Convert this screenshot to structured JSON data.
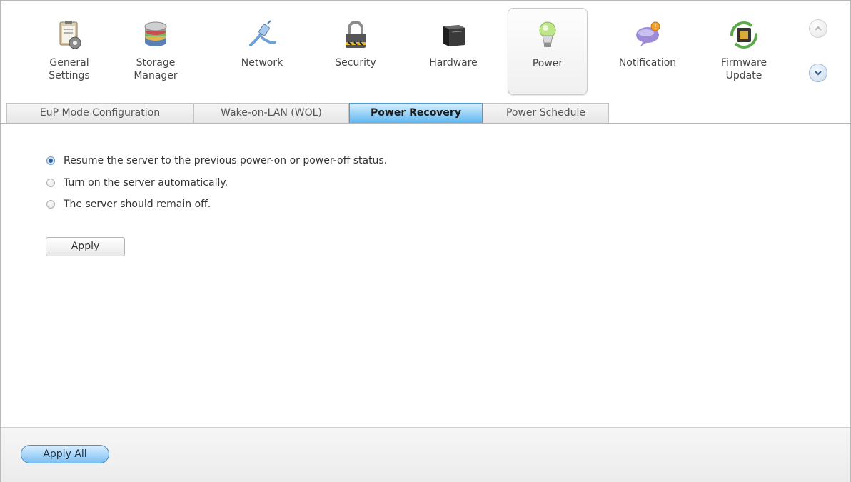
{
  "toolbar": {
    "items": [
      {
        "label": "General\nSettings",
        "icon": "clipboard-gear-icon"
      },
      {
        "label": "Storage\nManager",
        "icon": "disk-stack-icon"
      },
      {
        "label": "Network",
        "icon": "network-plug-icon"
      },
      {
        "label": "Security",
        "icon": "padlock-icon"
      },
      {
        "label": "Hardware",
        "icon": "server-box-icon"
      },
      {
        "label": "Power",
        "icon": "light-bulb-icon"
      },
      {
        "label": "Notification",
        "icon": "speech-bubble-icon"
      },
      {
        "label": "Firmware\nUpdate",
        "icon": "chip-update-icon"
      }
    ],
    "active": "Power"
  },
  "tabs": {
    "items": [
      "EuP Mode Configuration",
      "Wake-on-LAN (WOL)",
      "Power Recovery",
      "Power Schedule"
    ],
    "active": "Power Recovery"
  },
  "power_recovery": {
    "options": [
      "Resume the server to the previous power-on or power-off status.",
      "Turn on the server automatically.",
      "The server should remain off."
    ],
    "selected_index": 0,
    "apply_label": "Apply"
  },
  "footer": {
    "apply_all_label": "Apply All"
  },
  "colors": {
    "accent": "#5fb6ef",
    "accent_border": "#4b9fd8"
  }
}
